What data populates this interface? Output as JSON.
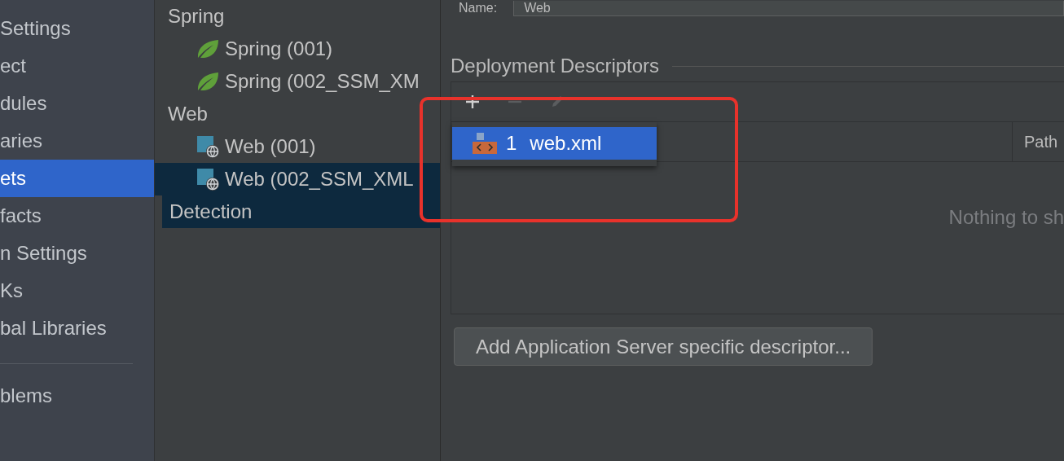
{
  "sidebar": {
    "items": [
      {
        "kind": "item",
        "label": "Settings",
        "selected": false
      },
      {
        "kind": "item",
        "label": "ect",
        "selected": false
      },
      {
        "kind": "item",
        "label": "dules",
        "selected": false
      },
      {
        "kind": "item",
        "label": "aries",
        "selected": false
      },
      {
        "kind": "item",
        "label": "ets",
        "selected": true
      },
      {
        "kind": "item",
        "label": "facts",
        "selected": false
      },
      {
        "kind": "item",
        "label": "n Settings",
        "selected": false
      },
      {
        "kind": "item",
        "label": "Ks",
        "selected": false
      },
      {
        "kind": "item",
        "label": "bal Libraries",
        "selected": false
      },
      {
        "kind": "separator"
      },
      {
        "kind": "item",
        "label": "blems",
        "selected": false
      }
    ]
  },
  "facet_tree": {
    "items": [
      {
        "kind": "group",
        "label": "Spring",
        "selected": false,
        "children": [
          {
            "kind": "spring",
            "label": "Spring (001)",
            "selected": false
          },
          {
            "kind": "spring",
            "label": "Spring (002_SSM_XM",
            "selected": false
          }
        ]
      },
      {
        "kind": "group",
        "label": "Web",
        "selected": false,
        "children": [
          {
            "kind": "web",
            "label": "Web (001)",
            "selected": false
          },
          {
            "kind": "web",
            "label": "Web (002_SSM_XML",
            "selected": true
          }
        ]
      },
      {
        "kind": "section",
        "label": "Detection",
        "selected": true
      }
    ]
  },
  "name_field": {
    "label": "Name:",
    "value": "Web"
  },
  "deployment_descriptors": {
    "title": "Deployment Descriptors",
    "toolbar": [
      {
        "kind": "add",
        "disabled": false
      },
      {
        "kind": "remove",
        "disabled": true
      },
      {
        "kind": "edit",
        "disabled": true
      }
    ],
    "table": {
      "columns": [
        "Path"
      ],
      "empty_text": "Nothing to sh"
    },
    "popup_menu": {
      "items": [
        {
          "number": "1",
          "label": "web.xml",
          "selected": true
        }
      ]
    },
    "button": "Add Application Server specific descriptor..."
  },
  "annotation": {
    "kind": "rectangle"
  }
}
